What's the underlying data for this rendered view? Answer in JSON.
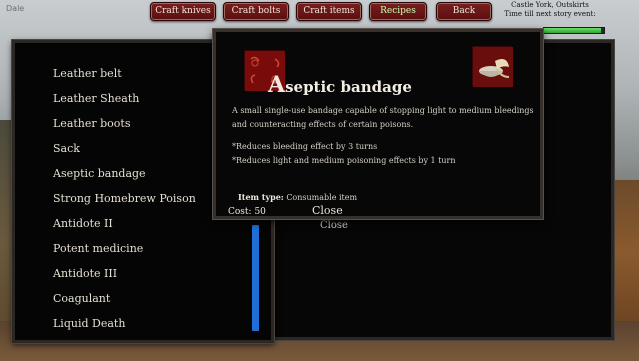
{
  "top_left_label": "Dale",
  "nav": {
    "buttons": [
      {
        "label": "Craft knives",
        "active": false
      },
      {
        "label": "Craft bolts",
        "active": false
      },
      {
        "label": "Craft items",
        "active": false
      },
      {
        "label": "Recipes",
        "active": true
      },
      {
        "label": "Back",
        "active": false
      }
    ]
  },
  "location": {
    "name": "Castle York, Outskirts",
    "story_timer_label": "Time till next story event:"
  },
  "health_fraction": 0.95,
  "recipe_list": {
    "items": [
      "Leather belt",
      "Leather Sheath",
      "Leather boots",
      "Sack",
      "Aseptic bandage",
      "Strong Homebrew Poison",
      "Antidote II",
      "Potent medicine",
      "Antidote III",
      "Coagulant",
      "Liquid Death"
    ]
  },
  "behind_panel": {
    "close_label": "Close"
  },
  "popup": {
    "title_initial": "A",
    "title_rest": "septic bandage",
    "description": "A small single-use bandage capable of stopping light to medium bleedings and counteracting effects of certain poisons.",
    "effects": [
      "*Reduces bleeding effect by 3 turns",
      "*Reduces light and medium poisoning effects by 1 turn"
    ],
    "item_type_label": "Item type:",
    "item_type_value": "Consumable item",
    "cost_label": "Cost:",
    "cost_value": "50",
    "close_label": "Close"
  },
  "colors": {
    "nav_button": "#6a1515",
    "active_nav_text": "#c9ffb8",
    "scrollbar": "#1f6fd6",
    "health": "#3fbf3f"
  }
}
